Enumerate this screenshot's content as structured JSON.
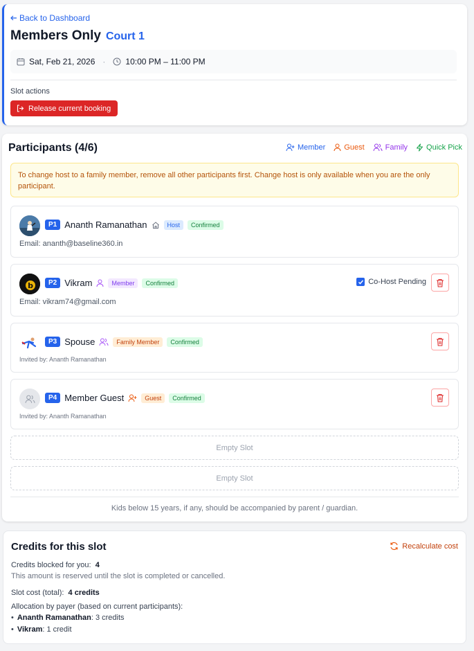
{
  "header": {
    "back_label": "Back to Dashboard",
    "title": "Members Only",
    "court": "Court 1",
    "date": "Sat, Feb 21, 2026",
    "time_separator": "·",
    "time": "10:00 PM – 11:00 PM",
    "slot_actions_label": "Slot actions",
    "release_label": "Release current booking"
  },
  "participants": {
    "title": "Participants (4/6)",
    "actions": {
      "member": "Member",
      "guest": "Guest",
      "family": "Family",
      "quick_pick": "Quick Pick"
    },
    "notice": "To change host to a family member, remove all other participants first. Change host is only available when you are the only participant.",
    "list": [
      {
        "slot": "P1",
        "name": "Ananth Ramanathan",
        "role": "Host",
        "status": "Confirmed",
        "detail": "Email: ananth@baseline360.in"
      },
      {
        "slot": "P2",
        "name": "Vikram",
        "role": "Member",
        "status": "Confirmed",
        "detail": "Email: vikram74@gmail.com",
        "cohost": "Co-Host Pending"
      },
      {
        "slot": "P3",
        "name": "Spouse",
        "role": "Family Member",
        "status": "Confirmed",
        "detail": "Invited by: Ananth Ramanathan"
      },
      {
        "slot": "P4",
        "name": "Member Guest",
        "role": "Guest",
        "status": "Confirmed",
        "detail": "Invited by: Ananth Ramanathan"
      }
    ],
    "empty_slot_label": "Empty Slot",
    "kids_note": "Kids below 15 years, if any, should be accompanied by parent / guardian."
  },
  "credits": {
    "title": "Credits for this slot",
    "recalculate": "Recalculate cost",
    "blocked_label": "Credits blocked for you:",
    "blocked_value": "4",
    "reserved_note": "This amount is reserved until the slot is completed or cancelled.",
    "slot_cost_label": "Slot cost (total):",
    "slot_cost_value": "4 credits",
    "allocation_label": "Allocation by payer (based on current participants):",
    "allocation": [
      {
        "name": "Ananth Ramanathan",
        "amount": ": 3 credits"
      },
      {
        "name": "Vikram",
        "amount": ": 1 credit"
      }
    ]
  },
  "colors": {
    "accent": "#2563eb",
    "danger": "#dc2626",
    "guest": "#ea580c",
    "family": "#9333ea",
    "quick_pick": "#16a34a"
  },
  "icons": [
    "arrow-left-icon",
    "calendar-icon",
    "clock-icon",
    "logout-icon",
    "user-plus-icon",
    "user-icon",
    "users-icon",
    "zap-icon",
    "home-icon",
    "trash-icon",
    "check-icon",
    "refresh-icon"
  ]
}
